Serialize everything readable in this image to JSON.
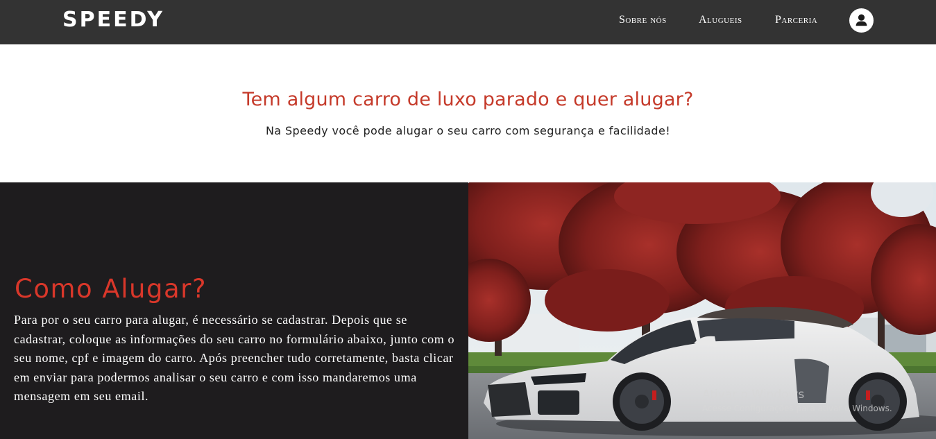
{
  "header": {
    "brand": "SPEEDY",
    "nav": {
      "about": "Sobre nós",
      "rentals": "Alugueis",
      "partnership": "Parceria"
    },
    "profile_icon": "user-circle-icon"
  },
  "intro": {
    "title": "Tem algum carro de luxo parado e quer alugar?",
    "subtitle": "Na Speedy você pode alugar o seu carro com segurança e facilidade!"
  },
  "how_to_rent": {
    "title": "Como Alugar?",
    "text": "Para por o seu carro para alugar, é necessário se cadastrar. Depois que se cadastrar, coloque as informações do seu carro no formulário abaixo, junto com o seu nome, cpf e imagem do carro. Após preencher tudo corretamente, basta clicar em enviar para podermos analisar o seu carro e com isso mandaremos uma mensagem em seu email."
  },
  "watermark": {
    "title": "Ativar o Windows",
    "subtitle": "Acesse Configurações para ativar o Windows."
  },
  "colors": {
    "header_bg": "#333333",
    "accent_red": "#d9372a",
    "dark_section_bg": "#1e1c1e"
  }
}
